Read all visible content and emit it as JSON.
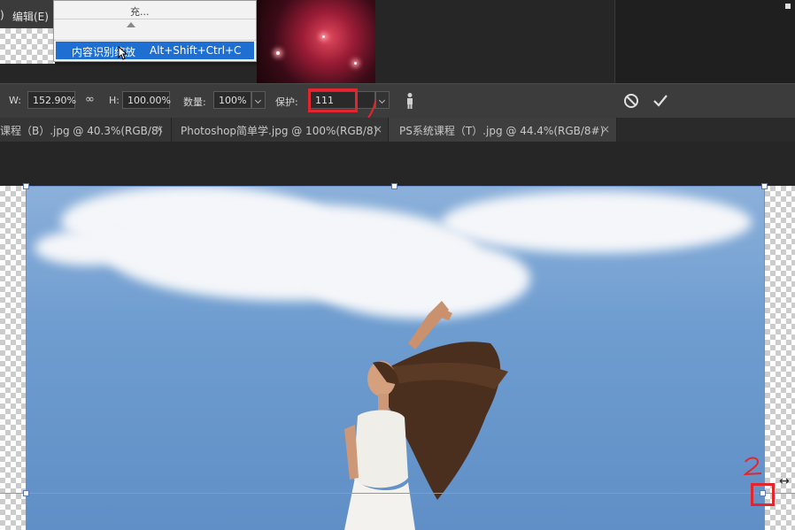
{
  "menu": {
    "paren": ")",
    "edit": "编辑(E)"
  },
  "dropdown": {
    "partial_item": "充...",
    "highlighted_item": "内容识别缩放",
    "shortcut": "Alt+Shift+Ctrl+C"
  },
  "options": {
    "w_label": "W:",
    "w_value": "152.90%",
    "link_icon": "link-icon",
    "h_label": "H:",
    "h_value": "100.00%",
    "amount_label": "数量:",
    "amount_value": "100%",
    "protect_label": "保护:",
    "protect_value": "111"
  },
  "tabs": [
    {
      "title": "课程（B）.jpg @ 40.3%(RGB/8)",
      "close": "×"
    },
    {
      "title": "Photoshop简单学.jpg @ 100%(RGB/8)",
      "close": "×"
    },
    {
      "title": "PS系统课程（T）.jpg @ 44.4%(RGB/8#)",
      "close": "×"
    }
  ],
  "colors": {
    "highlight_red": "#e3262d",
    "guide": "#d66bd9",
    "menu_highlight": "#1e6fd1"
  }
}
